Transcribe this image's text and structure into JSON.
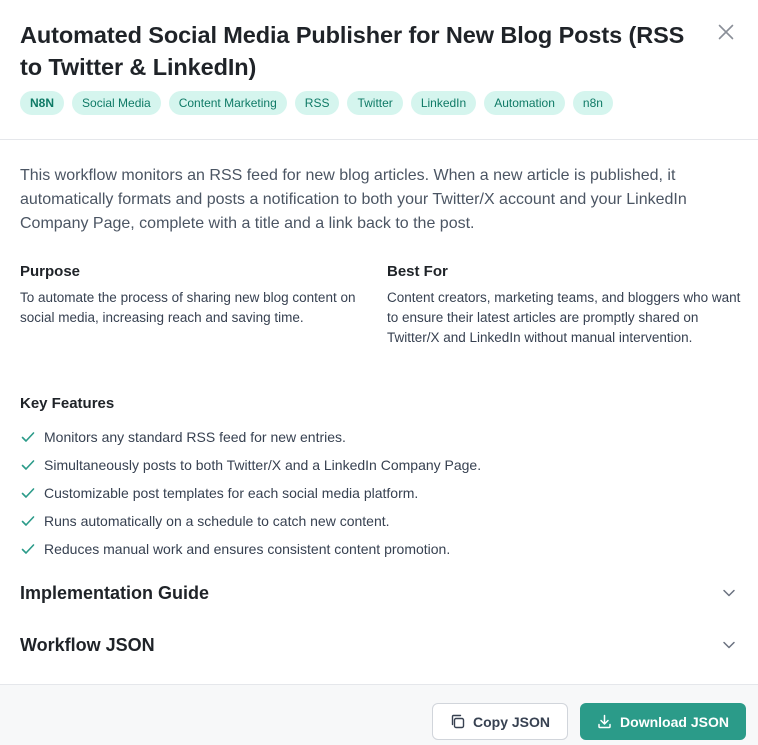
{
  "title": "Automated Social Media Publisher for New Blog Posts (RSS to Twitter & LinkedIn)",
  "tags": [
    "N8N",
    "Social Media",
    "Content Marketing",
    "RSS",
    "Twitter",
    "LinkedIn",
    "Automation",
    "n8n"
  ],
  "description": "This workflow monitors an RSS feed for new blog articles. When a new article is published, it automatically formats and posts a notification to both your Twitter/X account and your LinkedIn Company Page, complete with a title and a link back to the post.",
  "purpose": {
    "heading": "Purpose",
    "text": "To automate the process of sharing new blog content on social media, increasing reach and saving time."
  },
  "best_for": {
    "heading": "Best For",
    "text": "Content creators, marketing teams, and bloggers who want to ensure their latest articles are promptly shared on Twitter/X and LinkedIn without manual intervention."
  },
  "key_features": {
    "heading": "Key Features",
    "items": [
      "Monitors any standard RSS feed for new entries.",
      "Simultaneously posts to both Twitter/X and a LinkedIn Company Page.",
      "Customizable post templates for each social media platform.",
      "Runs automatically on a schedule to catch new content.",
      "Reduces manual work and ensures consistent content promotion."
    ]
  },
  "accordions": {
    "implementation": "Implementation Guide",
    "workflow_json": "Workflow JSON"
  },
  "footer": {
    "copy_label": "Copy JSON",
    "download_label": "Download JSON"
  },
  "colors": {
    "accent": "#2b9b89",
    "tag_bg": "#d5f5ee",
    "tag_text": "#0f7a66",
    "check": "#2b9b89"
  }
}
